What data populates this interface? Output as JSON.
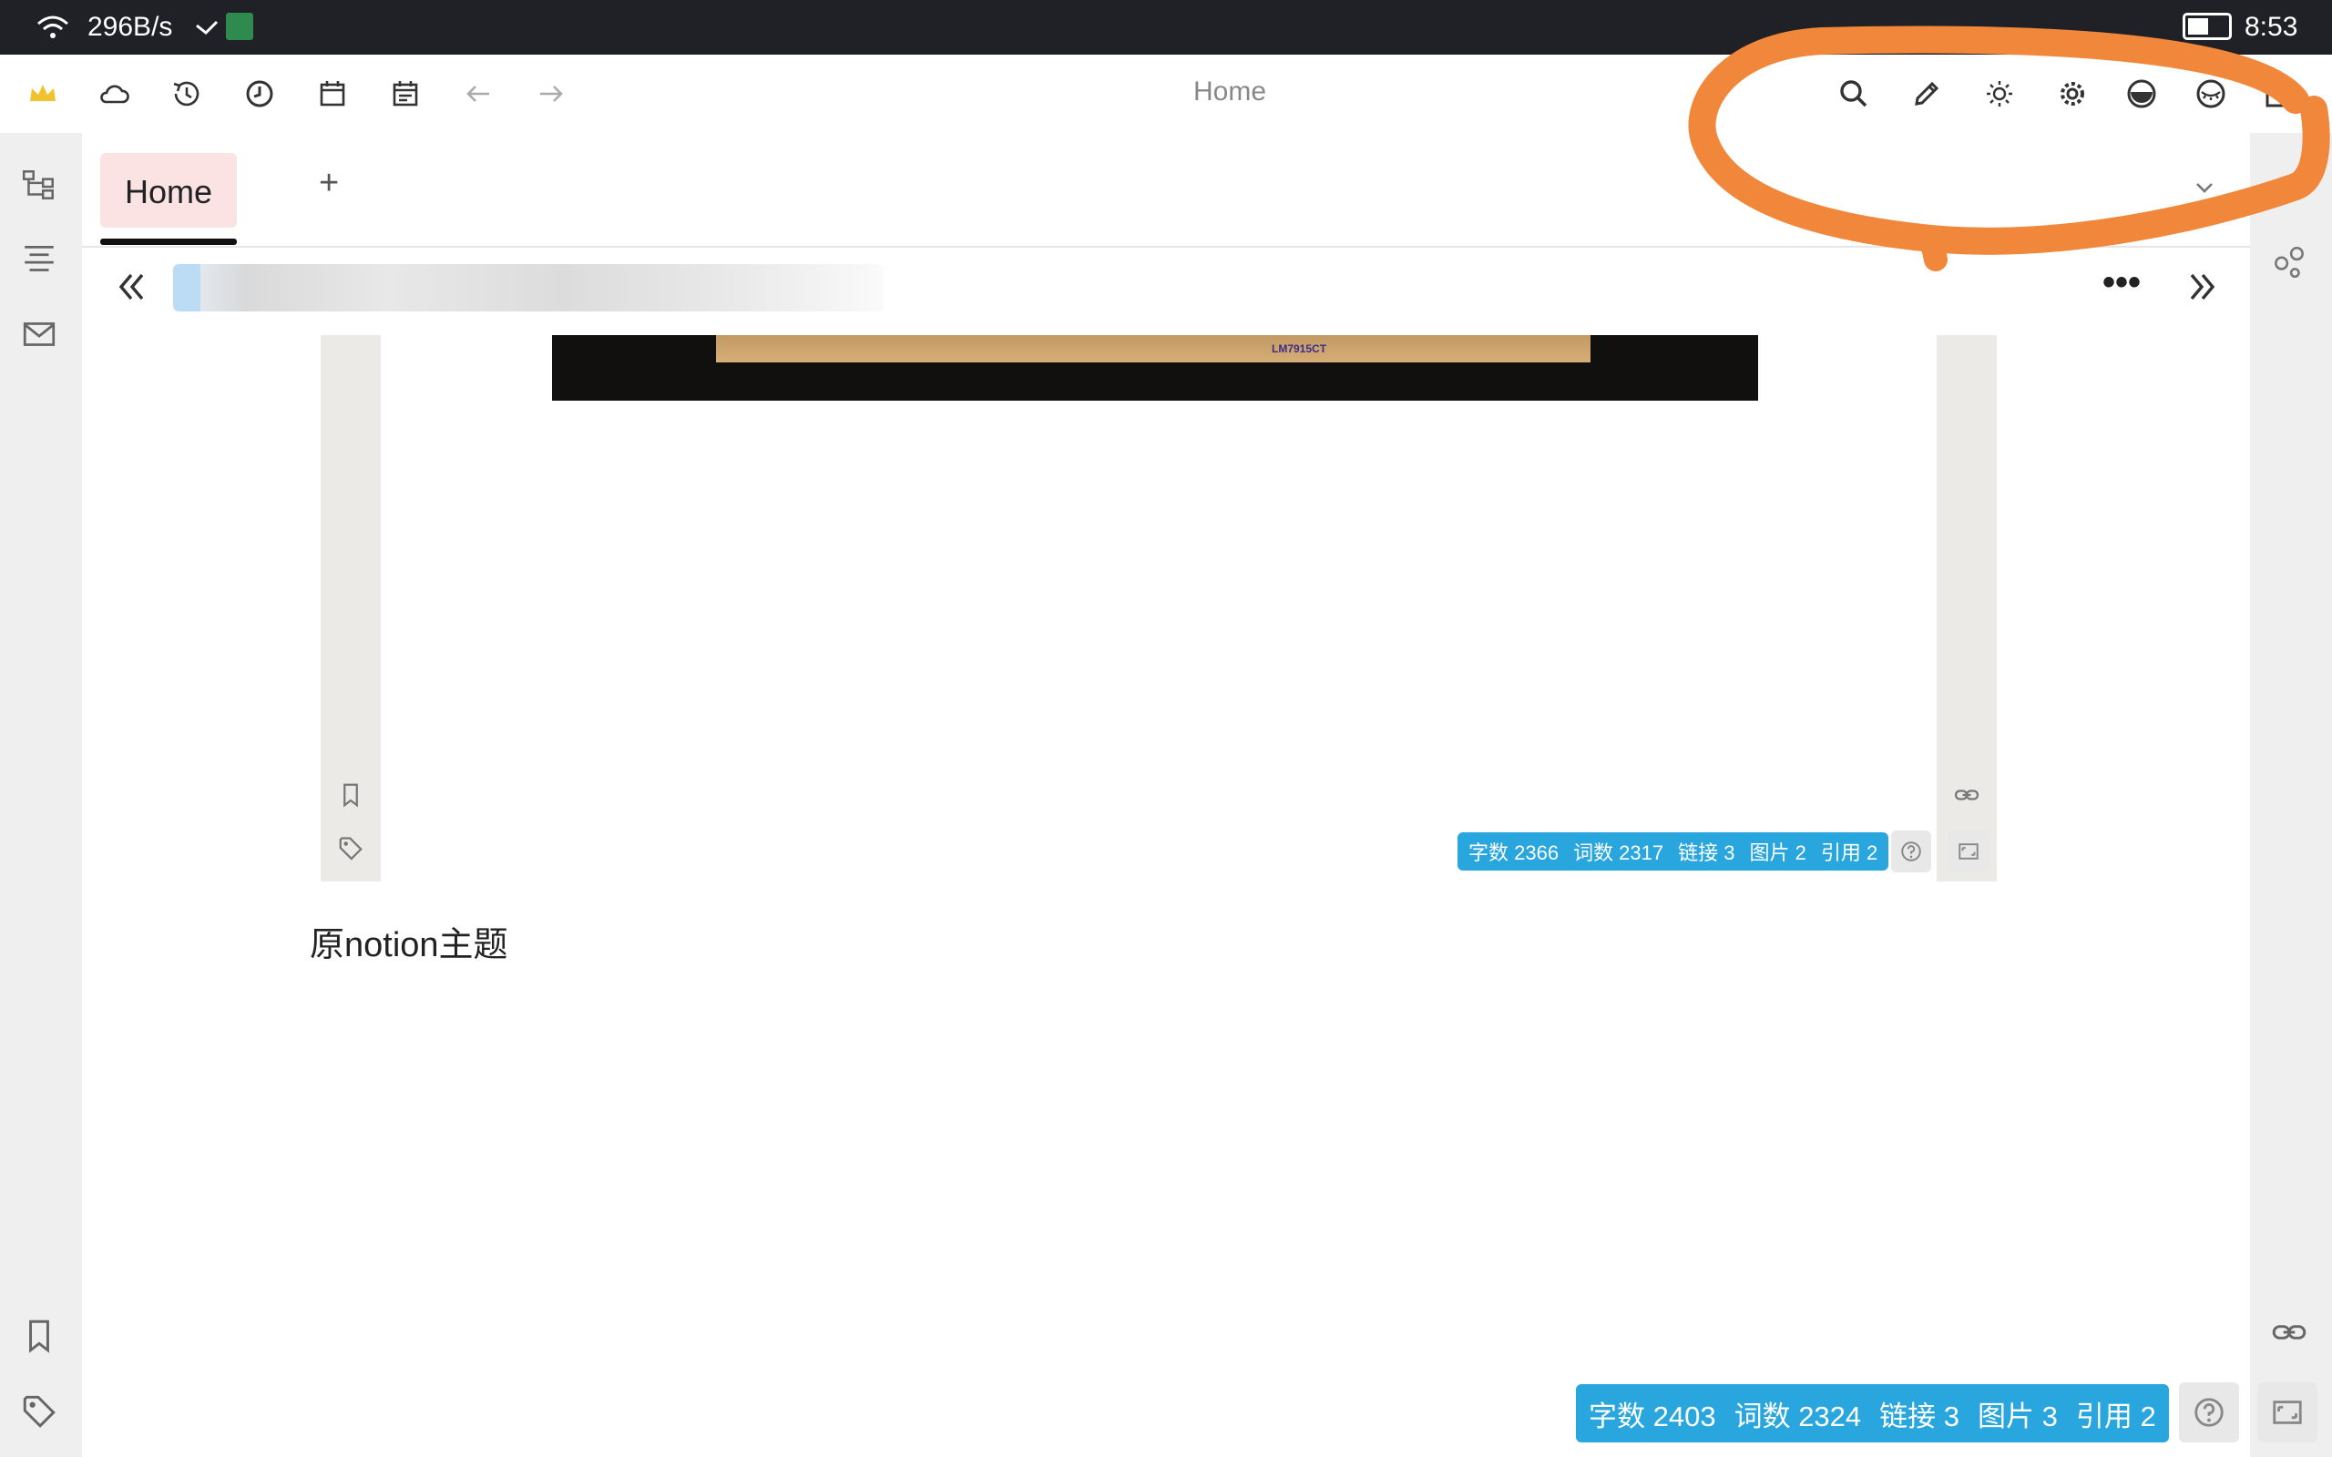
{
  "status_bar": {
    "net_speed": "296B/s",
    "time": "8:53"
  },
  "toolbar": {
    "title": "Home",
    "left_icons": [
      "crown-icon",
      "cloud-icon",
      "history-icon",
      "clock-icon",
      "calendar-icon",
      "daily-note-icon",
      "back-arrow-icon",
      "forward-arrow-icon"
    ],
    "right_icons": [
      "search-icon",
      "edit-pencil-icon",
      "brightness-icon",
      "gear-icon",
      "theme-toggle-icon",
      "eye-closed-icon",
      "window-icon"
    ]
  },
  "tabs": {
    "active_label": "Home",
    "add_label": "+"
  },
  "breadcrumb": {
    "more_label": "•••"
  },
  "inner_document": {
    "photo_label": "LM7915CT",
    "stats": [
      "字数 2366",
      "词数 2317",
      "链接 3",
      "图片 2",
      "引用 2"
    ]
  },
  "document": {
    "paragraph": "原notion主题"
  },
  "footer_stats": [
    "字数 2403",
    "词数 2324",
    "链接 3",
    "图片 3",
    "引用 2"
  ],
  "colors": {
    "badge": "#2aa6de",
    "tab_active": "#fbe3e3",
    "annotation": "#f0873a",
    "crown": "#f2c12e"
  }
}
